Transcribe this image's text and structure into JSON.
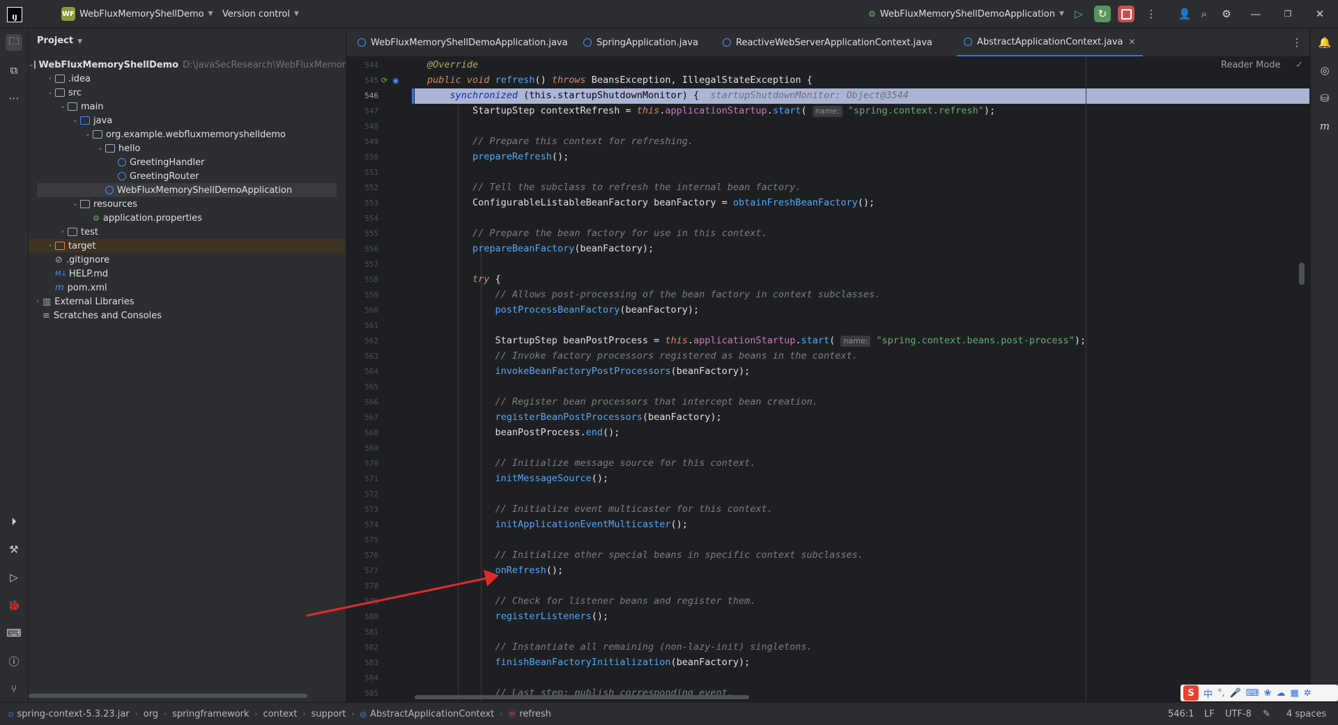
{
  "titlebar": {
    "project_badge": "WF",
    "project_name": "WebFluxMemoryShellDemo",
    "vcs": "Version control",
    "run_config": "WebFluxMemoryShellDemoApplication"
  },
  "project_panel": {
    "header": "Project",
    "tree": [
      {
        "label": "WebFluxMemoryShellDemo",
        "path": "D:\\javaSecResearch\\WebFluxMemory",
        "indent": 0,
        "kind": "module",
        "open": true,
        "bold": true
      },
      {
        "label": ".idea",
        "indent": 1,
        "kind": "folder",
        "open": false
      },
      {
        "label": "src",
        "indent": 1,
        "kind": "folder",
        "open": true
      },
      {
        "label": "main",
        "indent": 2,
        "kind": "folder",
        "open": true
      },
      {
        "label": "java",
        "indent": 3,
        "kind": "java",
        "open": true
      },
      {
        "label": "org.example.webfluxmemoryshelldemo",
        "indent": 4,
        "kind": "package",
        "open": true
      },
      {
        "label": "hello",
        "indent": 5,
        "kind": "package",
        "open": true
      },
      {
        "label": "GreetingHandler",
        "indent": 6,
        "kind": "class"
      },
      {
        "label": "GreetingRouter",
        "indent": 6,
        "kind": "class"
      },
      {
        "label": "WebFluxMemoryShellDemoApplication",
        "indent": 5,
        "kind": "class",
        "selected": true
      },
      {
        "label": "resources",
        "indent": 3,
        "kind": "resources",
        "open": true
      },
      {
        "label": "application.properties",
        "indent": 4,
        "kind": "props"
      },
      {
        "label": "test",
        "indent": 2,
        "kind": "folder",
        "open": false
      },
      {
        "label": "target",
        "indent": 1,
        "kind": "target",
        "open": false,
        "highlight": true
      },
      {
        "label": ".gitignore",
        "indent": 1,
        "kind": "ignore"
      },
      {
        "label": "HELP.md",
        "indent": 1,
        "kind": "md"
      },
      {
        "label": "pom.xml",
        "indent": 1,
        "kind": "maven"
      },
      {
        "label": "External Libraries",
        "indent": 0,
        "kind": "libs",
        "open": false
      },
      {
        "label": "Scratches and Consoles",
        "indent": 0,
        "kind": "scratch"
      }
    ]
  },
  "tabs": [
    {
      "label": "WebFluxMemoryShellDemoApplication.java"
    },
    {
      "label": "SpringApplication.java"
    },
    {
      "label": "ReactiveWebServerApplicationContext.java"
    },
    {
      "label": "AbstractApplicationContext.java",
      "active": true
    }
  ],
  "editor": {
    "reader_mode": "Reader Mode",
    "line_numbers": [
      "544",
      "545",
      "546",
      "547",
      "548",
      "549",
      "550",
      "551",
      "552",
      "553",
      "554",
      "555",
      "556",
      "557",
      "558",
      "559",
      "560",
      "561",
      "562",
      "563",
      "564",
      "565",
      "566",
      "567",
      "568",
      "569",
      "570",
      "571",
      "572",
      "573",
      "574",
      "575",
      "576",
      "577",
      "578",
      "579",
      "580",
      "581",
      "582",
      "583",
      "584",
      "585"
    ],
    "current_line": "546",
    "lines": [
      [
        {
          "t": "@Override",
          "c": "ann"
        }
      ],
      [
        {
          "t": "public void ",
          "c": "kw"
        },
        {
          "t": "refresh",
          "c": "fn"
        },
        {
          "t": "() ",
          "c": "typ"
        },
        {
          "t": "throws ",
          "c": "kw"
        },
        {
          "t": "BeansException, IllegalStateException {",
          "c": "typ"
        }
      ],
      [
        {
          "t": "    synchronized ",
          "c": "kwx"
        },
        {
          "t": "(this.startupShutdownMonitor) {  ",
          "c": "plain"
        },
        {
          "t": "startupShutdownMonitor: Object@3544",
          "c": "dbgx"
        }
      ],
      [
        {
          "t": "        StartupStep contextRefresh = ",
          "c": "typ"
        },
        {
          "t": "this",
          "c": "kw"
        },
        {
          "t": ".",
          "c": "typ"
        },
        {
          "t": "applicationStartup",
          "c": "fld"
        },
        {
          "t": ".",
          "c": "typ"
        },
        {
          "t": "start",
          "c": "fn"
        },
        {
          "t": "( ",
          "c": "typ"
        },
        {
          "t": "name:",
          "c": "hint"
        },
        {
          "t": " \"spring.context.refresh\"",
          "c": "str"
        },
        {
          "t": ");",
          "c": "typ"
        }
      ],
      [],
      [
        {
          "t": "        // Prepare this context for refreshing.",
          "c": "cmt"
        }
      ],
      [
        {
          "t": "        ",
          "c": "typ"
        },
        {
          "t": "prepareRefresh",
          "c": "fn"
        },
        {
          "t": "();",
          "c": "typ"
        }
      ],
      [],
      [
        {
          "t": "        // Tell the subclass to refresh the internal bean factory.",
          "c": "cmt"
        }
      ],
      [
        {
          "t": "        ConfigurableListableBeanFactory beanFactory = ",
          "c": "typ"
        },
        {
          "t": "obtainFreshBeanFactory",
          "c": "fn"
        },
        {
          "t": "();",
          "c": "typ"
        }
      ],
      [],
      [
        {
          "t": "        // Prepare the bean factory for use in this context.",
          "c": "cmt"
        }
      ],
      [
        {
          "t": "        ",
          "c": "typ"
        },
        {
          "t": "prepareBeanFactory",
          "c": "fn"
        },
        {
          "t": "(beanFactory);",
          "c": "typ"
        }
      ],
      [],
      [
        {
          "t": "        ",
          "c": "typ"
        },
        {
          "t": "try",
          "c": "kw"
        },
        {
          "t": " {",
          "c": "typ"
        }
      ],
      [
        {
          "t": "            // Allows post-processing of the bean factory in context subclasses.",
          "c": "cmt"
        }
      ],
      [
        {
          "t": "            ",
          "c": "typ"
        },
        {
          "t": "postProcessBeanFactory",
          "c": "fn"
        },
        {
          "t": "(beanFactory);",
          "c": "typ"
        }
      ],
      [],
      [
        {
          "t": "            StartupStep beanPostProcess = ",
          "c": "typ"
        },
        {
          "t": "this",
          "c": "kw"
        },
        {
          "t": ".",
          "c": "typ"
        },
        {
          "t": "applicationStartup",
          "c": "fld"
        },
        {
          "t": ".",
          "c": "typ"
        },
        {
          "t": "start",
          "c": "fn"
        },
        {
          "t": "( ",
          "c": "typ"
        },
        {
          "t": "name:",
          "c": "hint"
        },
        {
          "t": " \"spring.context.beans.post-process\"",
          "c": "str"
        },
        {
          "t": ");",
          "c": "typ"
        }
      ],
      [
        {
          "t": "            // Invoke factory processors registered as beans in the context.",
          "c": "cmt"
        }
      ],
      [
        {
          "t": "            ",
          "c": "typ"
        },
        {
          "t": "invokeBeanFactoryPostProcessors",
          "c": "fn"
        },
        {
          "t": "(beanFactory);",
          "c": "typ"
        }
      ],
      [],
      [
        {
          "t": "            // Register bean processors that intercept bean creation.",
          "c": "cmt"
        }
      ],
      [
        {
          "t": "            ",
          "c": "typ"
        },
        {
          "t": "registerBeanPostProcessors",
          "c": "fn"
        },
        {
          "t": "(beanFactory);",
          "c": "typ"
        }
      ],
      [
        {
          "t": "            beanPostProcess.",
          "c": "typ"
        },
        {
          "t": "end",
          "c": "fn"
        },
        {
          "t": "();",
          "c": "typ"
        }
      ],
      [],
      [
        {
          "t": "            // Initialize message source for this context.",
          "c": "cmt"
        }
      ],
      [
        {
          "t": "            ",
          "c": "typ"
        },
        {
          "t": "initMessageSource",
          "c": "fn"
        },
        {
          "t": "();",
          "c": "typ"
        }
      ],
      [],
      [
        {
          "t": "            // Initialize event multicaster for this context.",
          "c": "cmt"
        }
      ],
      [
        {
          "t": "            ",
          "c": "typ"
        },
        {
          "t": "initApplicationEventMulticaster",
          "c": "fn"
        },
        {
          "t": "();",
          "c": "typ"
        }
      ],
      [],
      [
        {
          "t": "            // Initialize other special beans in specific context subclasses.",
          "c": "cmt"
        }
      ],
      [
        {
          "t": "            ",
          "c": "typ"
        },
        {
          "t": "onRefresh",
          "c": "fn"
        },
        {
          "t": "();",
          "c": "typ"
        }
      ],
      [],
      [
        {
          "t": "            // Check for listener beans and register them.",
          "c": "cmt"
        }
      ],
      [
        {
          "t": "            ",
          "c": "typ"
        },
        {
          "t": "registerListeners",
          "c": "fn"
        },
        {
          "t": "();",
          "c": "typ"
        }
      ],
      [],
      [
        {
          "t": "            // Instantiate all remaining (non-lazy-init) singletons.",
          "c": "cmt"
        }
      ],
      [
        {
          "t": "            ",
          "c": "typ"
        },
        {
          "t": "finishBeanFactoryInitialization",
          "c": "fn"
        },
        {
          "t": "(beanFactory);",
          "c": "typ"
        }
      ],
      [],
      [
        {
          "t": "            // Last step: publish corresponding event.",
          "c": "cmt"
        }
      ]
    ]
  },
  "statusbar": {
    "breadcrumbs": [
      "spring-context-5.3.23.jar",
      "org",
      "springframework",
      "context",
      "support",
      "AbstractApplicationContext",
      "refresh"
    ],
    "position": "546:1",
    "line_ending": "LF",
    "encoding": "UTF-8",
    "indent": "4 spaces"
  },
  "ime": {
    "logo": "S",
    "mode": "中"
  },
  "colors": {
    "accent": "#3574f0",
    "annotation_arrow": "#e32a2a"
  }
}
